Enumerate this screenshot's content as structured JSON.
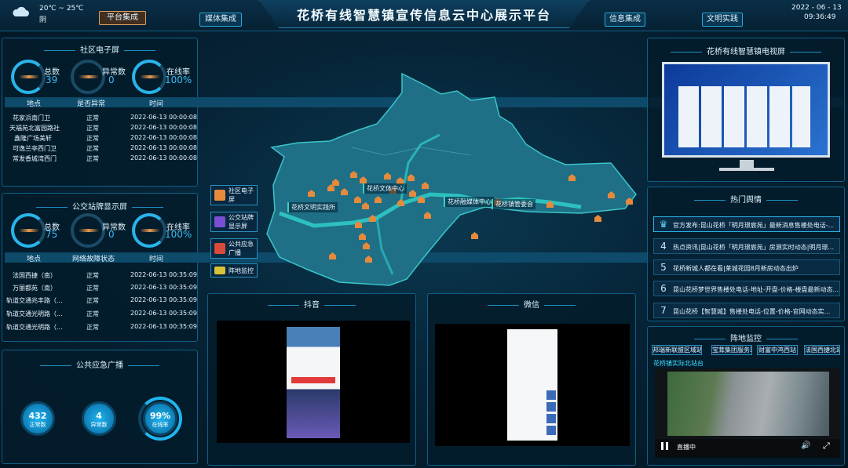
{
  "header": {
    "title": "花桥有线智慧镇宣传信息云中心展示平台",
    "weather_temp": "20℃ ~ 25℃",
    "weather_desc": "阴",
    "date": "2022 - 06 - 13",
    "time": "09:36:49",
    "nav": [
      "平台集成",
      "媒体集成",
      "信息集成",
      "文明实践"
    ],
    "active_nav": "平台集成"
  },
  "community_screen": {
    "title": "社区电子屏",
    "stats": [
      {
        "label": "总数",
        "value": "39"
      },
      {
        "label": "异常数",
        "value": "0"
      },
      {
        "label": "在线率",
        "value": "100%"
      }
    ],
    "columns": [
      "地点",
      "是否异常",
      "时间"
    ],
    "rows": [
      [
        "花家浜南门卫",
        "正常",
        "2022-06-13 00:00:08"
      ],
      [
        "天福苑北富园路社",
        "正常",
        "2022-06-13 00:00:08"
      ],
      [
        "鑫隆广场美轩",
        "正常",
        "2022-06-13 00:00:08"
      ],
      [
        "可逸兰亭西门卫",
        "正常",
        "2022-06-13 00:00:08"
      ],
      [
        "常发香城湾西门",
        "正常",
        "2022-06-13 00:00:08"
      ]
    ]
  },
  "bus_screen": {
    "title": "公交站牌显示屏",
    "stats": [
      {
        "label": "总数",
        "value": "75"
      },
      {
        "label": "异常数",
        "value": "0"
      },
      {
        "label": "在线率",
        "value": "100%"
      }
    ],
    "columns": [
      "地点",
      "网络故障状态",
      "时间"
    ],
    "rows": [
      [
        "法国西捷（南）",
        "正常",
        "2022-06-13 00:35:09"
      ],
      [
        "万丽都苑（南）",
        "正常",
        "2022-06-13 00:35:09"
      ],
      [
        "轨道交通兆丰路（...",
        "正常",
        "2022-06-13 00:35:09"
      ],
      [
        "轨道交通光明路（...",
        "正常",
        "2022-06-13 00:35:09"
      ],
      [
        "轨道交通光明路（...",
        "正常",
        "2022-06-13 00:35:09"
      ]
    ]
  },
  "broadcast": {
    "title": "公共应急广播",
    "items": [
      {
        "value": "432",
        "label": "正常数"
      },
      {
        "value": "4",
        "label": "异常数"
      },
      {
        "value": "99%",
        "label": "在线率"
      }
    ]
  },
  "map": {
    "labels": [
      "花桥文体中心",
      "花桥文明实践所",
      "花桥融媒体中心",
      "花桥镇管委会"
    ],
    "side_buttons": [
      "社区电子屏",
      "公交站牌显示屏",
      "公共应急广播",
      "阵地监控"
    ]
  },
  "douyin": {
    "title": "抖音"
  },
  "wechat": {
    "title": "微信"
  },
  "tv": {
    "title": "花桥有线智慧镇电视屏"
  },
  "hot_news": {
    "title": "热门舆情",
    "items": [
      {
        "num": "",
        "text": "官方发布:昆山花桥「明月璟宸苑」最新消息售楼处电话-..."
      },
      {
        "num": "4",
        "text": "热点资讯|昆山花桥「明月璟宸苑」房源实时动态|明月璟..."
      },
      {
        "num": "5",
        "text": "花桥新城人都在看|莱城花园8月新房动态出炉"
      },
      {
        "num": "6",
        "text": "昆山花桥梦世界售楼处电话-地址-开盘-价格-楼盘最新动态..."
      },
      {
        "num": "7",
        "text": "昆山花桥【智慧城】售楼处电话-位置-价格-官网动态实..."
      }
    ]
  },
  "monitor": {
    "title": "阵地监控",
    "tabs": [
      "邦瑞新联盟区域站",
      "宝茸集团服务站",
      "财富中鸿西站",
      "法国西捷北站"
    ],
    "current": "花桥镇实际北站台",
    "live_label": "直播中"
  }
}
